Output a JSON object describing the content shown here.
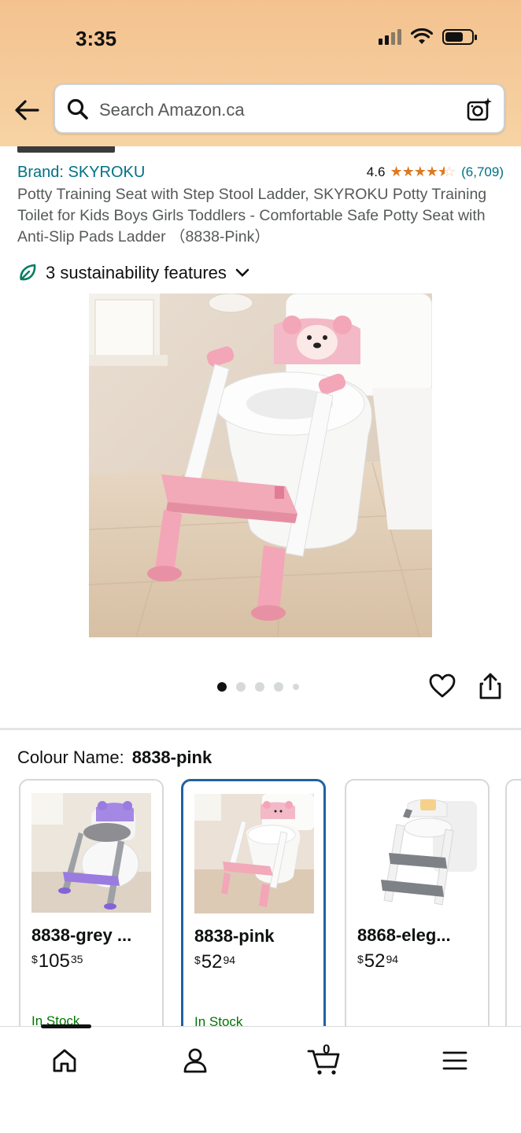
{
  "status_bar": {
    "time": "3:35"
  },
  "search": {
    "placeholder": "Search Amazon.ca"
  },
  "product": {
    "brand": "Brand: SKYROKU",
    "rating": "4.6",
    "rating_value": 4.6,
    "rating_count": "(6,709)",
    "title": "Potty Training Seat with Step Stool Ladder, SKYROKU Potty Training Toilet for Kids Boys Girls Toddlers - Comfortable Safe Potty Seat with Anti-Slip Pads Ladder （8838-Pink）",
    "sustainability": "3 sustainability features"
  },
  "carousel": {
    "total": 5,
    "active": 1
  },
  "colour": {
    "label": "Colour Name:",
    "value": "8838-pink"
  },
  "variants": [
    {
      "name": "8838-grey ...",
      "currency": "$",
      "dollars": "105",
      "cents": "35",
      "stock": "In Stock",
      "color": "#9a7be0",
      "selected": false
    },
    {
      "name": "8838-pink",
      "currency": "$",
      "dollars": "52",
      "cents": "94",
      "stock": "In Stock",
      "color": "#f0a7b6",
      "selected": true
    },
    {
      "name": "8868-eleg...",
      "currency": "$",
      "dollars": "52",
      "cents": "94",
      "stock": "",
      "color": "#7e8287",
      "selected": false
    }
  ],
  "icons": {
    "back": "back-arrow-icon",
    "search": "search-icon",
    "camera": "camera-icon",
    "leaf": "leaf-icon",
    "heart": "heart-icon",
    "share": "share-icon",
    "home": "home-icon",
    "account": "account-icon",
    "cart": "cart-icon",
    "menu": "menu-icon"
  },
  "cart": {
    "count": "0"
  },
  "colors": {
    "brand_link": "#007185",
    "star": "#de7921",
    "selected_border": "#2162a1",
    "header": "#f3c28f",
    "in_stock": "#007600"
  }
}
